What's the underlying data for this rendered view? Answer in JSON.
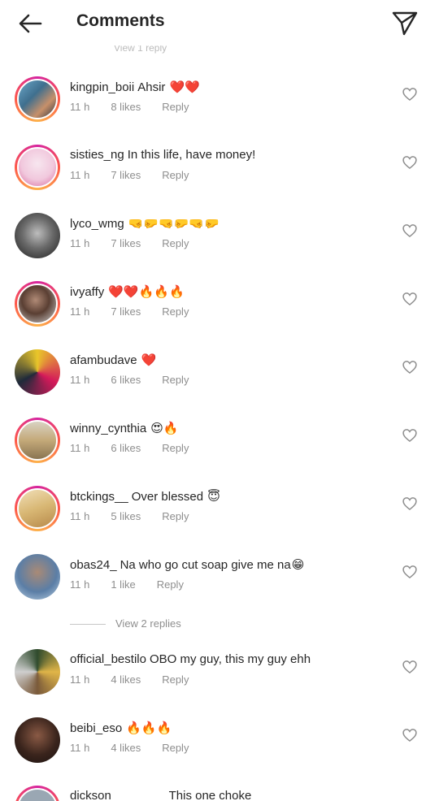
{
  "header": {
    "title": "Comments",
    "back_icon": "arrow-left-icon",
    "share_icon": "paper-plane-icon"
  },
  "top_ghost_text": "View 1 reply",
  "comments": [
    {
      "username": "kingpin_boii",
      "text": "Ahsir",
      "emoji": "❤️❤️",
      "time": "11 h",
      "likes": "8 likes",
      "reply": "Reply"
    },
    {
      "username": "sisties_ng",
      "text": "In this life, have money!",
      "emoji": "",
      "time": "11 h",
      "likes": "7 likes",
      "reply": "Reply"
    },
    {
      "username": "lyco_wmg",
      "text": "",
      "emoji": "🤜🤛🤜🤛🤜🤛",
      "time": "11 h",
      "likes": "7 likes",
      "reply": "Reply"
    },
    {
      "username": "ivyaffy",
      "text": "",
      "emoji": "❤️❤️🔥🔥🔥",
      "time": "11 h",
      "likes": "7 likes",
      "reply": "Reply"
    },
    {
      "username": "afambudave",
      "text": "",
      "emoji": "❤️",
      "time": "11 h",
      "likes": "6 likes",
      "reply": "Reply"
    },
    {
      "username": "winny_cynthia",
      "text": "",
      "emoji": "😍🔥",
      "time": "11 h",
      "likes": "6 likes",
      "reply": "Reply"
    },
    {
      "username": "btckings__",
      "text": "Over blessed",
      "emoji": "😇",
      "time": "11 h",
      "likes": "5 likes",
      "reply": "Reply"
    },
    {
      "username": "obas24_",
      "text": "Na who go cut soap give me na",
      "emoji": "😁",
      "time": "11 h",
      "likes": "1 like",
      "reply": "Reply"
    },
    {
      "username": "official_bestilo",
      "text": "OBO my guy, this my guy ehh",
      "emoji": "",
      "time": "11 h",
      "likes": "4 likes",
      "reply": "Reply"
    },
    {
      "username": "beibi_eso",
      "text": "",
      "emoji": "🔥🔥🔥",
      "time": "11 h",
      "likes": "4 likes",
      "reply": "Reply"
    },
    {
      "username": "dickson________",
      "text": "This one choke",
      "emoji": "",
      "time": "",
      "likes": "",
      "reply": ""
    }
  ],
  "view_replies": "View 2 replies",
  "icons": {
    "like": "heart-outline-icon"
  },
  "colors": {
    "text": "#262626",
    "meta": "#8e8e8e",
    "accent": "#d6249f"
  }
}
